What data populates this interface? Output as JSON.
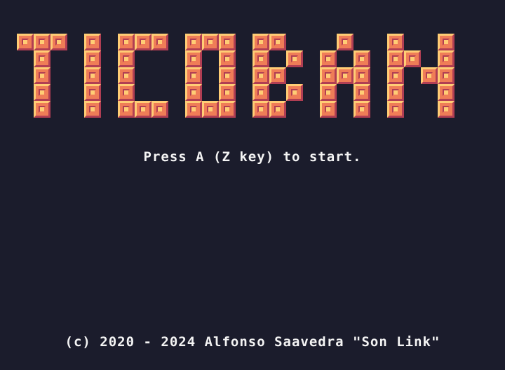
{
  "game": {
    "title": "TICOBAN",
    "prompt": "Press A (Z key) to start.",
    "credits": "(c) 2020 - 2024 Alfonso Saavedra \"Son Link\""
  },
  "colors": {
    "background": "#1b1c2c",
    "tile_face": "#ef7d57",
    "tile_highlight": "#ffcd75",
    "tile_shadow": "#b13e53",
    "text": "#f4f4f4"
  }
}
